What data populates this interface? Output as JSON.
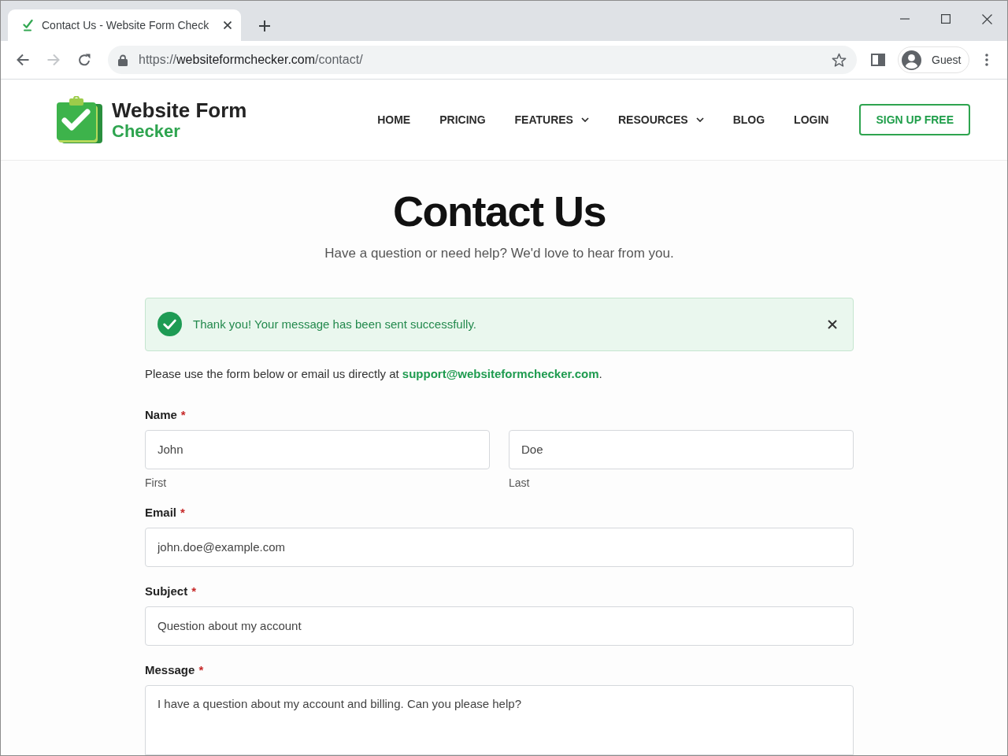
{
  "browser": {
    "tab": {
      "title": "Contact Us - Website Form Check"
    },
    "nav_buttons": [
      {
        "kind": "back",
        "disabled": false
      },
      {
        "kind": "forward",
        "disabled": true
      },
      {
        "kind": "reload",
        "disabled": false
      }
    ],
    "address_bar": {
      "scheme": "https://",
      "host": "websiteformchecker.com",
      "path": "/contact/"
    },
    "profile": {
      "label": "Guest"
    }
  },
  "site_header": {
    "brand": {
      "line_1": "Website Form",
      "line_2": "Checker"
    },
    "nav": [
      {
        "label": "HOME",
        "has_menu": false
      },
      {
        "label": "PRICING",
        "has_menu": false
      },
      {
        "label": "FEATURES",
        "has_menu": true
      },
      {
        "label": "RESOURCES",
        "has_menu": true
      },
      {
        "label": "BLOG",
        "has_menu": false
      },
      {
        "label": "LOGIN",
        "has_menu": false
      }
    ],
    "cta_button": "SIGN UP FREE"
  },
  "page": {
    "title": "Contact Us",
    "subtitle": "Have a question or need help? We'd love to hear from you.",
    "alert": {
      "kind": "success",
      "message": "Thank you! Your message has been sent successfully.",
      "dismissible": true
    },
    "intro": {
      "text": "Please use the form below or email us directly at ",
      "link": "support@websiteformchecker.com",
      "after": "."
    },
    "form": {
      "fields": [
        {
          "kind": "split",
          "label": "Name",
          "required_mark": "*",
          "inputs": [
            {
              "value": "John",
              "sublabel": "First"
            },
            {
              "value": "Doe",
              "sublabel": "Last"
            }
          ]
        },
        {
          "kind": "text",
          "label": "Email",
          "required_mark": "*",
          "inputs": [
            {
              "value": "john.doe@example.com"
            }
          ]
        },
        {
          "kind": "text",
          "label": "Subject",
          "required_mark": "*",
          "inputs": [
            {
              "value": "Question about my account"
            }
          ]
        },
        {
          "kind": "textarea",
          "label": "Message",
          "required_mark": "*",
          "inputs": [
            {
              "value": "I have a question about my account and billing. Can you please help?"
            }
          ]
        }
      ]
    }
  }
}
